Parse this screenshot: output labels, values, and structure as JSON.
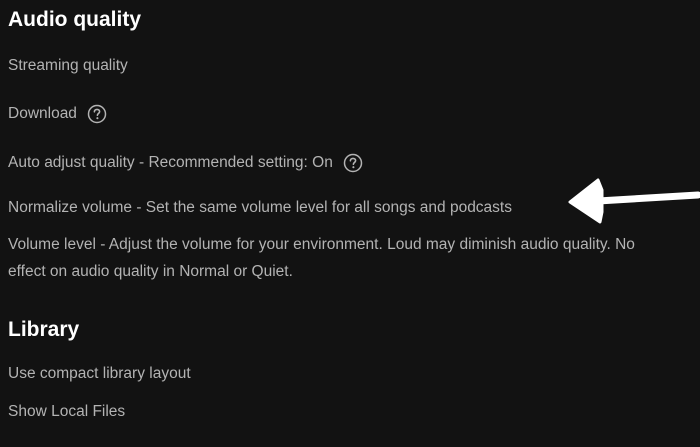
{
  "audio_quality": {
    "heading": "Audio quality",
    "items": [
      {
        "label": "Streaming quality"
      },
      {
        "label": "Download",
        "icon": "help-circle-icon"
      },
      {
        "label": "Auto adjust quality - Recommended setting: On",
        "icon": "help-circle-icon"
      },
      {
        "label": "Normalize volume - Set the same volume level for all songs and podcasts"
      },
      {
        "label": "Volume level - Adjust the volume for your environment. Loud may diminish audio quality. No effect on audio quality in Normal or Quiet."
      }
    ]
  },
  "library": {
    "heading": "Library",
    "items": [
      {
        "label": "Use compact library layout"
      },
      {
        "label": "Show Local Files"
      }
    ]
  },
  "annotation": {
    "icon": "arrow-left-icon",
    "color": "#ffffff"
  },
  "colors": {
    "background": "#121212",
    "heading": "#ffffff",
    "text": "#b3b3b3"
  }
}
